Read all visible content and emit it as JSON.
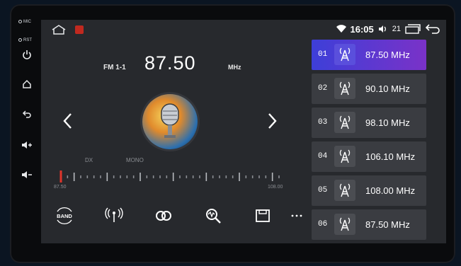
{
  "side": {
    "mic_label": "MIC",
    "rst_label": "RST",
    "icons": [
      "power-icon",
      "home-icon",
      "back-icon",
      "volume-up-icon",
      "volume-down-icon"
    ]
  },
  "status": {
    "time": "16:05",
    "volume": "21",
    "icons": [
      "home-icon",
      "app-icon",
      "wifi-icon",
      "volume-icon",
      "windows-icon",
      "back-icon"
    ]
  },
  "radio": {
    "band": "FM 1-1",
    "frequency": "87.50",
    "unit": "MHz",
    "dx": "DX",
    "mono": "MONO",
    "scale_min": "87.50",
    "scale_max": "108.00",
    "tuner_fraction": 0.0
  },
  "toolbar": {
    "band_label": "BAND",
    "icons": [
      "band-icon",
      "scan-antenna-icon",
      "stereo-icon",
      "search-icon",
      "save-icon",
      "more-icon"
    ]
  },
  "presets": [
    {
      "num": "01",
      "freq": "87.50 MHz",
      "active": true
    },
    {
      "num": "02",
      "freq": "90.10 MHz",
      "active": false
    },
    {
      "num": "03",
      "freq": "98.10 MHz",
      "active": false
    },
    {
      "num": "04",
      "freq": "106.10 MHz",
      "active": false
    },
    {
      "num": "05",
      "freq": "108.00 MHz",
      "active": false
    },
    {
      "num": "06",
      "freq": "87.50 MHz",
      "active": false
    }
  ],
  "colors": {
    "accent_start": "#3d3fd8",
    "accent_end": "#7a32c8",
    "tuner_marker": "#e0352b"
  }
}
